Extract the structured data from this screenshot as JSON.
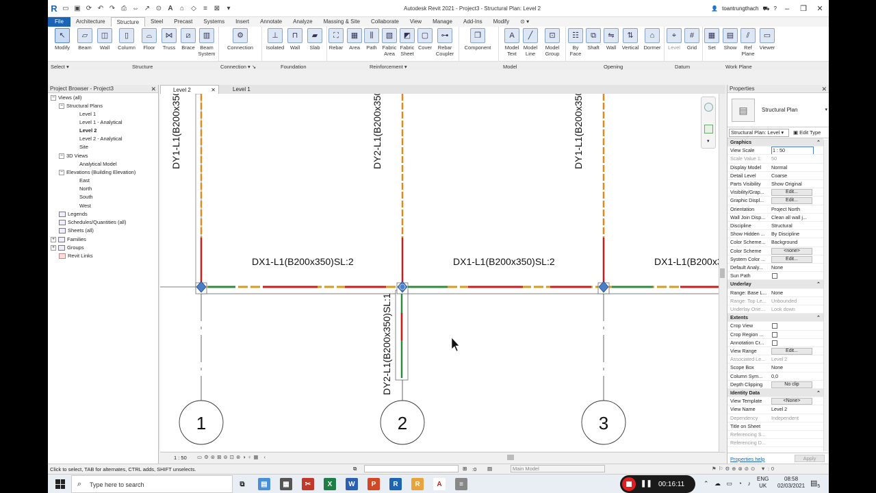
{
  "window": {
    "title": "Autodesk Revit 2021 - Project3 - Structural Plan: Level 2",
    "user": "toantrungthach"
  },
  "tabs": [
    "File",
    "Architecture",
    "Structure",
    "Steel",
    "Precast",
    "Systems",
    "Insert",
    "Annotate",
    "Analyze",
    "Massing & Site",
    "Collaborate",
    "View",
    "Manage",
    "Add-Ins",
    "Modify"
  ],
  "active_tab": "Structure",
  "ribbon": {
    "select": {
      "modify": "Modify",
      "select": "Select"
    },
    "structure": {
      "beam": "Beam",
      "wall": "Wall",
      "column": "Column",
      "floor": "Floor",
      "truss": "Truss",
      "brace": "Brace",
      "beam_system_1": "Beam",
      "beam_system_2": "System",
      "panel": "Structure"
    },
    "connection": {
      "connection": "Connection",
      "panel": "Connection"
    },
    "foundation": {
      "isolated": "Isolated",
      "wall": "Wall",
      "slab": "Slab",
      "panel": "Foundation"
    },
    "reinforcement": {
      "rebar": "Rebar",
      "area": "Area",
      "path": "Path",
      "fabric_area_1": "Fabric",
      "fabric_area_2": "Area",
      "fabric_sheet_1": "Fabric",
      "fabric_sheet_2": "Sheet",
      "cover": "Cover",
      "rebar_coupler_1": "Rebar",
      "rebar_coupler_2": "Coupler",
      "panel": "Reinforcement"
    },
    "model": {
      "component": "Component",
      "model_text_1": "Model",
      "model_text_2": "Text",
      "model_line_1": "Model",
      "model_line_2": "Line",
      "model_group_1": "Model",
      "model_group_2": "Group",
      "panel": "Model"
    },
    "opening": {
      "by_face_1": "By",
      "by_face_2": "Face",
      "shaft": "Shaft",
      "wall": "Wall",
      "vertical": "Vertical",
      "dormer": "Dormer",
      "panel": "Opening"
    },
    "datum": {
      "level": "Level",
      "grid": "Grid",
      "panel": "Datum"
    },
    "work_plane": {
      "set": "Set",
      "show": "Show",
      "ref_plane_1": "Ref",
      "ref_plane_2": "Plane",
      "viewer": "Viewer",
      "panel": "Work Plane"
    }
  },
  "project_browser": {
    "title": "Project Browser - Project3",
    "nodes": [
      {
        "label": "Views (all)"
      },
      {
        "label": "Structural Plans"
      },
      {
        "label": "Level 1"
      },
      {
        "label": "Level 1 - Analytical"
      },
      {
        "label": "Level 2"
      },
      {
        "label": "Level 2 - Analytical"
      },
      {
        "label": "Site"
      },
      {
        "label": "3D Views"
      },
      {
        "label": "Analytical Model"
      },
      {
        "label": "Elevations (Building Elevation)"
      },
      {
        "label": "East"
      },
      {
        "label": "North"
      },
      {
        "label": "South"
      },
      {
        "label": "West"
      },
      {
        "label": "Legends"
      },
      {
        "label": "Schedules/Quantities (all)"
      },
      {
        "label": "Sheets (all)"
      },
      {
        "label": "Families"
      },
      {
        "label": "Groups"
      },
      {
        "label": "Revit Links"
      }
    ]
  },
  "view_tabs": [
    {
      "label": "Level 2"
    },
    {
      "label": "Level 1"
    }
  ],
  "drawing": {
    "beam_dy1": "DY1-L1(B200x350",
    "beam_dy2": "DY2-L1(B200x350",
    "beam_dy1_b": "DY1-L1(B200x350",
    "beam_dy2_lower": "DY2-L1(B200x350)SL:1",
    "beam_dx1_a": "DX1-L1(B200x350)SL:2",
    "beam_dx1_b": "DX1-L1(B200x350)SL:2",
    "beam_dx1_c": "DX1-L1(B200x3",
    "grids": [
      "1",
      "2",
      "3"
    ]
  },
  "view_control": {
    "scale": "1 : 50"
  },
  "properties": {
    "title": "Properties",
    "type_name": "Structural Plan",
    "filter": "Structural Plan: Level",
    "edit_type": "Edit Type",
    "rows": [
      {
        "k": "Graphics",
        "v": ""
      },
      {
        "k": "View Scale",
        "v": "1 : 50"
      },
      {
        "k": "Scale Value    1:",
        "v": "50"
      },
      {
        "k": "Display Model",
        "v": "Normal"
      },
      {
        "k": "Detail Level",
        "v": "Coarse"
      },
      {
        "k": "Parts Visibility",
        "v": "Show Original"
      },
      {
        "k": "Visibility/Grap...",
        "v": "Edit..."
      },
      {
        "k": "Graphic Displ...",
        "v": "Edit..."
      },
      {
        "k": "Orientation",
        "v": "Project North"
      },
      {
        "k": "Wall Join Disp...",
        "v": "Clean all wall j..."
      },
      {
        "k": "Discipline",
        "v": "Structural"
      },
      {
        "k": "Show Hidden ...",
        "v": "By Discipline"
      },
      {
        "k": "Color Scheme...",
        "v": "Background"
      },
      {
        "k": "Color Scheme",
        "v": "<none>"
      },
      {
        "k": "System Color ...",
        "v": "Edit..."
      },
      {
        "k": "Default Analy...",
        "v": "None"
      },
      {
        "k": "Sun Path",
        "v": ""
      },
      {
        "k": "Underlay",
        "v": ""
      },
      {
        "k": "Range: Base L...",
        "v": "None"
      },
      {
        "k": "Range: Top Le...",
        "v": "Unbounded"
      },
      {
        "k": "Underlay Orie...",
        "v": "Look down"
      },
      {
        "k": "Extents",
        "v": ""
      },
      {
        "k": "Crop View",
        "v": ""
      },
      {
        "k": "Crop Region ...",
        "v": ""
      },
      {
        "k": "Annotation Cr...",
        "v": ""
      },
      {
        "k": "View Range",
        "v": "Edit..."
      },
      {
        "k": "Associated Le...",
        "v": "Level 2"
      },
      {
        "k": "Scope Box",
        "v": "None"
      },
      {
        "k": "Column Sym...",
        "v": "0,0"
      },
      {
        "k": "Depth Clipping",
        "v": "No clip"
      },
      {
        "k": "Identity Data",
        "v": ""
      },
      {
        "k": "View Template",
        "v": "<None>"
      },
      {
        "k": "View Name",
        "v": "Level 2"
      },
      {
        "k": "Dependency",
        "v": "Independent"
      },
      {
        "k": "Title on Sheet",
        "v": ""
      },
      {
        "k": "Referencing S...",
        "v": ""
      },
      {
        "k": "Referencing D...",
        "v": ""
      }
    ],
    "help": "Properties help",
    "apply": "Apply"
  },
  "status": {
    "hint": "Click to select, TAB for alternates, CTRL adds, SHIFT unselects.",
    "zero": ":0",
    "model": "Main Model"
  },
  "taskbar": {
    "search": "Type here to search",
    "recording_time": "00:16:11",
    "lang1": "ENG",
    "lang2": "UK",
    "time": "08:58",
    "date": "02/03/2021",
    "notif": "5"
  }
}
